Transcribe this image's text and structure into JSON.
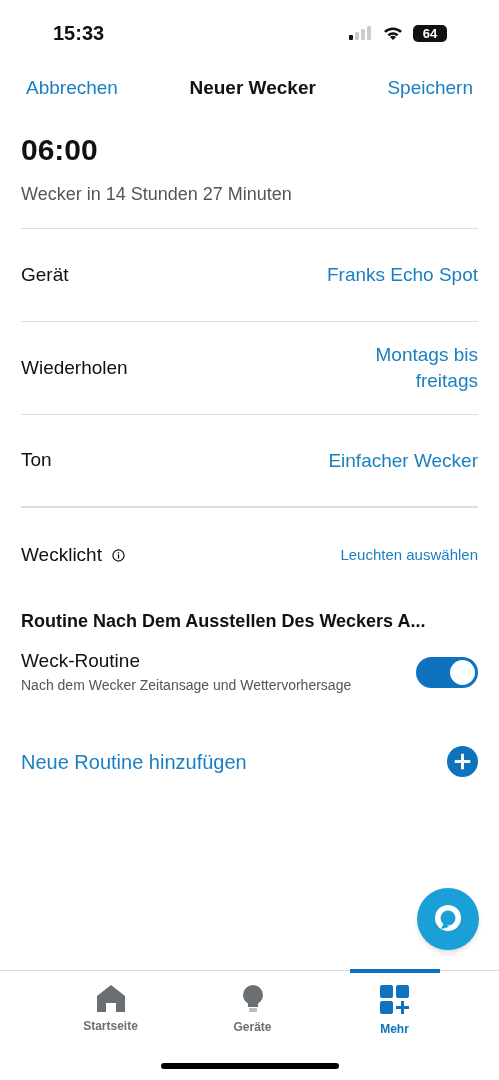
{
  "status_bar": {
    "time": "15:33",
    "battery": "64"
  },
  "nav": {
    "cancel": "Abbrechen",
    "title": "Neuer Wecker",
    "save": "Speichern"
  },
  "alarm": {
    "time": "06:00",
    "countdown": "Wecker in 14 Stunden 27 Minuten"
  },
  "settings": [
    {
      "label": "Gerät",
      "value": "Franks Echo Spot"
    },
    {
      "label": "Wiederholen",
      "value": "Montags bis freitags"
    },
    {
      "label": "Ton",
      "value": "Einfacher Wecker"
    }
  ],
  "wake_light": {
    "label": "Wecklicht",
    "action": "Leuchten auswählen"
  },
  "routine_section": {
    "heading": "Routine Nach Dem Ausstellen Des Weckers A...",
    "routine": {
      "title": "Weck-Routine",
      "description": "Nach dem Wecker Zeitansage und Wettervorhersage",
      "on": true
    },
    "add": "Neue Routine hinzufügen"
  },
  "tabs": [
    {
      "kind": "home",
      "label": "Startseite",
      "selected": false
    },
    {
      "kind": "devices",
      "label": "Geräte",
      "selected": false
    },
    {
      "kind": "more",
      "label": "Mehr",
      "selected": true
    }
  ]
}
